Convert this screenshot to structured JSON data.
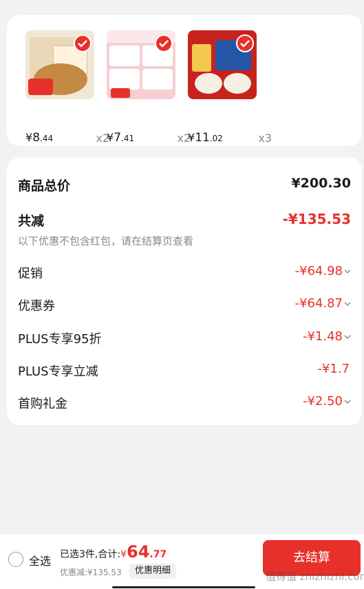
{
  "products": [
    {
      "price_int": "8",
      "price_dec": ".44",
      "qty": "x2",
      "image": "cookie-box-image"
    },
    {
      "price_int": "7",
      "price_dec": ".41",
      "qty": "x2",
      "image": "snack-pack-image"
    },
    {
      "price_int": "11",
      "price_dec": ".02",
      "qty": "x3",
      "image": "oatmeal-box-image"
    }
  ],
  "currency": "¥",
  "summary": {
    "total_label": "商品总价",
    "total_value": "¥200.30",
    "reduce_label": "共减",
    "reduce_value": "-¥135.53",
    "note": "以下优惠不包含红包，请在结算页查看",
    "items": [
      {
        "label": "促销",
        "value": "-¥64.98"
      },
      {
        "label": "优惠券",
        "value": "-¥64.87"
      },
      {
        "label": "PLUS专享95折",
        "value": "-¥1.48"
      },
      {
        "label": "PLUS专享立减",
        "value": "-¥1.7"
      },
      {
        "label": "首购礼金",
        "value": "-¥2.50"
      }
    ]
  },
  "bottom": {
    "select_all": "全选",
    "selected_text": "已选3件,合计:",
    "total_cur": "¥",
    "total_int": "64",
    "total_dec": ".77",
    "discount_text": "优惠减:¥135.53",
    "detail_btn": "优惠明细",
    "checkout_btn": "去结算"
  },
  "watermark": "值得值 zhizhizhi.com",
  "colors": {
    "accent": "#e8302a",
    "background": "#f2f2f2"
  }
}
